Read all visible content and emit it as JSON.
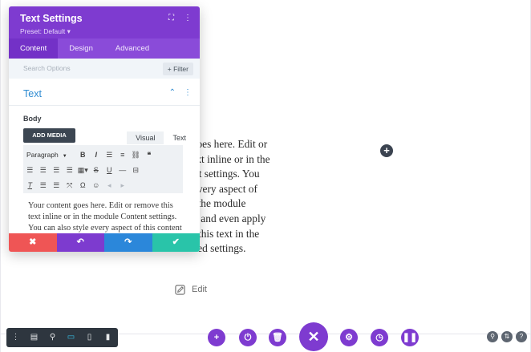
{
  "modal": {
    "title": "Text Settings",
    "preset": "Preset: Default ▾",
    "tabs": [
      "Content",
      "Design",
      "Advanced"
    ],
    "search_placeholder": "Search Options",
    "filter_label": "+ Filter",
    "section_title": "Text",
    "body_label": "Body",
    "add_media_label": "ADD MEDIA",
    "editor_tab_visual": "Visual",
    "editor_tab_text": "Text",
    "format_select": "Paragraph",
    "editor_content": "Your content goes here. Edit or remove this text inline or in the module Content settings. You can also style every aspect of this content in the module Design settings and even apply custom CSS to this text in the module Advanced settings."
  },
  "canvas": {
    "module_text_lines": [
      "content goes here. Edit or",
      "ve this text inline or in the",
      "le Content settings. You",
      "so style every aspect of",
      "ontent in the module",
      "n settings and even apply",
      "n CSS to this text in the",
      "e Advanced settings."
    ],
    "edit_label": "Edit"
  },
  "colors": {
    "primary_purple": "#7e3bd0",
    "link_blue": "#2e8bd1",
    "cancel_red": "#ef5555",
    "redo_blue": "#2b87da",
    "save_teal": "#29c4a9",
    "dark_toolbar": "#2e363f",
    "active_device": "#35c2e8"
  },
  "icons": {
    "modal_header": [
      "expand-icon",
      "more-vertical-icon"
    ],
    "section_header": [
      "chevron-up-icon",
      "more-vertical-icon"
    ],
    "bottom_left_toolbar": [
      "more-vertical-icon",
      "wireframe-icon",
      "zoom-icon",
      "desktop-icon",
      "tablet-icon",
      "phone-icon"
    ],
    "bottom_center": [
      "add-icon",
      "power-icon",
      "trash-icon",
      "close-icon",
      "settings-icon",
      "history-icon",
      "pause-icon"
    ],
    "bottom_right": [
      "search-icon",
      "portability-icon",
      "help-icon"
    ]
  }
}
